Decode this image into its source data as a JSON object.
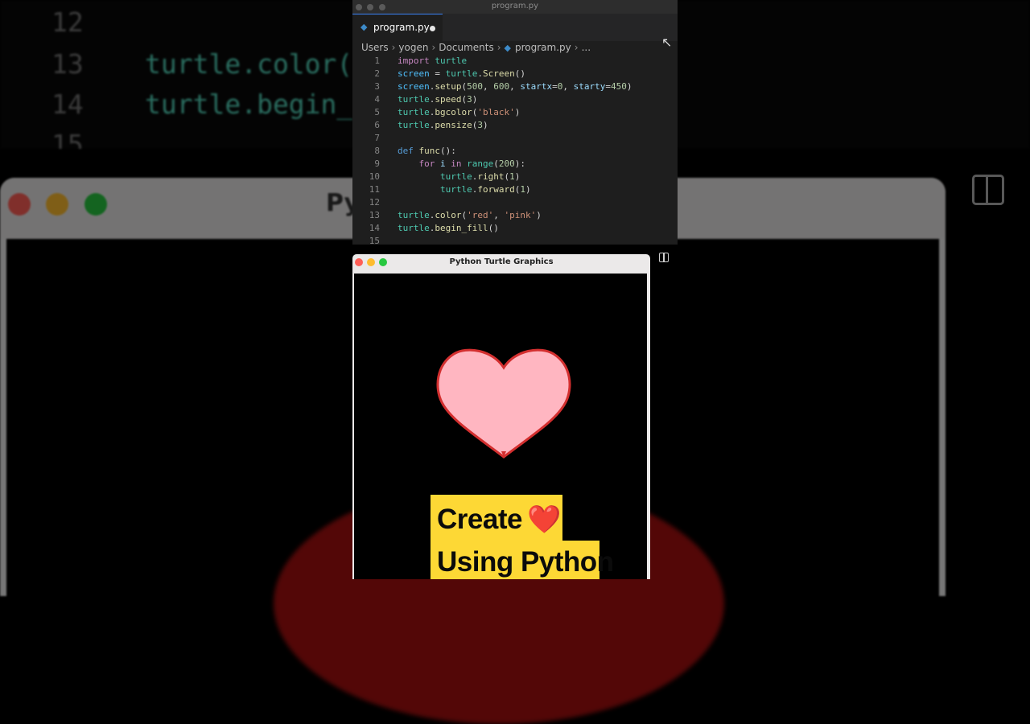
{
  "background": {
    "lines": [
      {
        "num": "12",
        "code": ""
      },
      {
        "num": "13",
        "code": "turtle.color("
      },
      {
        "num": "14",
        "code": "turtle.begin_"
      },
      {
        "num": "15",
        "code": ""
      }
    ],
    "window_title": "Py"
  },
  "editor": {
    "window_title": "program.py",
    "tab": {
      "label": "program.py",
      "icon": "python-file-icon",
      "unsaved": true
    },
    "breadcrumb": [
      "Users",
      "yogen",
      "Documents",
      "program.py",
      "..."
    ],
    "lines": [
      {
        "n": "1",
        "code": "import turtle"
      },
      {
        "n": "2",
        "code": "screen = turtle.Screen()"
      },
      {
        "n": "3",
        "code": "screen.setup(500, 600, startx=0, starty=450)"
      },
      {
        "n": "4",
        "code": "turtle.speed(3)"
      },
      {
        "n": "5",
        "code": "turtle.bgcolor('black')"
      },
      {
        "n": "6",
        "code": "turtle.pensize(3)"
      },
      {
        "n": "7",
        "code": ""
      },
      {
        "n": "8",
        "code": "def func():"
      },
      {
        "n": "9",
        "code": "    for i in range(200):"
      },
      {
        "n": "10",
        "code": "        turtle.right(1)"
      },
      {
        "n": "11",
        "code": "        turtle.forward(1)"
      },
      {
        "n": "12",
        "code": ""
      },
      {
        "n": "13",
        "code": "turtle.color('red', 'pink')"
      },
      {
        "n": "14",
        "code": "turtle.begin_fill()"
      },
      {
        "n": "15",
        "code": ""
      }
    ]
  },
  "turtle_window": {
    "title": "Python Turtle Graphics",
    "heart": {
      "outline": "#d32f2f",
      "fill": "#ffb6c1"
    }
  },
  "caption": {
    "line1": "Create",
    "emoji": "❤️",
    "line2": "Using Python",
    "bg": "#fdd835"
  }
}
